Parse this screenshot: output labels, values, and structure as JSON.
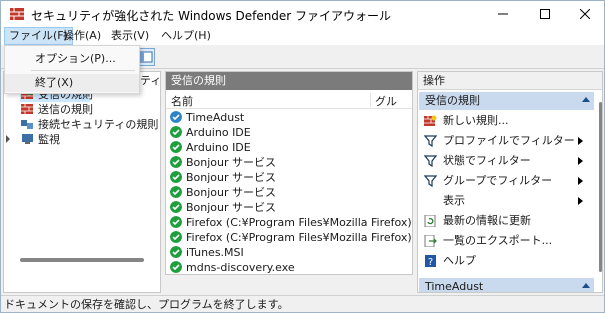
{
  "window": {
    "title": "セキュリティが強化された Windows Defender ファイアウォール"
  },
  "menubar": {
    "file": "ファイル(F)",
    "operation": "操作(A)",
    "view": "表示(V)",
    "help": "ヘルプ(H)"
  },
  "file_menu": {
    "options": "オプション(P)...",
    "exit": "終了(X)"
  },
  "tree": {
    "partial_label": "ティ",
    "items": [
      {
        "label": "受信の規則",
        "icon": "inbound-rules-icon"
      },
      {
        "label": "送信の規則",
        "icon": "outbound-rules-icon"
      },
      {
        "label": "接続セキュリティの規則",
        "icon": "connection-security-icon"
      },
      {
        "label": "監視",
        "icon": "monitor-icon"
      }
    ]
  },
  "rules_pane": {
    "header": "受信の規則",
    "col_name": "名前",
    "col_group": "グル",
    "rows": [
      "TimeAdust",
      "Arduino IDE",
      "Arduino IDE",
      "Bonjour サービス",
      "Bonjour サービス",
      "Bonjour サービス",
      "Bonjour サービス",
      "Firefox (C:¥Program Files¥Mozilla Firefox)",
      "Firefox (C:¥Program Files¥Mozilla Firefox)",
      "iTunes.MSI",
      "mdns-discovery.exe"
    ]
  },
  "actions": {
    "title": "操作",
    "section1": "受信の規則",
    "items": [
      {
        "label": "新しい規則...",
        "icon": "new-rule-icon",
        "submenu": false
      },
      {
        "label": "プロファイルでフィルター",
        "icon": "filter-icon",
        "submenu": true
      },
      {
        "label": "状態でフィルター",
        "icon": "filter-icon",
        "submenu": true
      },
      {
        "label": "グループでフィルター",
        "icon": "filter-icon",
        "submenu": true
      },
      {
        "label": "表示",
        "icon": "",
        "submenu": true
      },
      {
        "label": "最新の情報に更新",
        "icon": "refresh-icon",
        "submenu": false
      },
      {
        "label": "一覧のエクスポート...",
        "icon": "export-icon",
        "submenu": false
      },
      {
        "label": "ヘルプ",
        "icon": "help-icon",
        "submenu": false
      }
    ],
    "section2": "TimeAdust"
  },
  "status": {
    "text": "ドキュメントの保存を確認し、プログラムを終了します。"
  },
  "colors": {
    "accent": "#0078d7",
    "pane_header": "#7b7b7b",
    "section_header": "#c9d9ee",
    "check_green": "#1e9e3c",
    "check_blue": "#2b84c6"
  }
}
